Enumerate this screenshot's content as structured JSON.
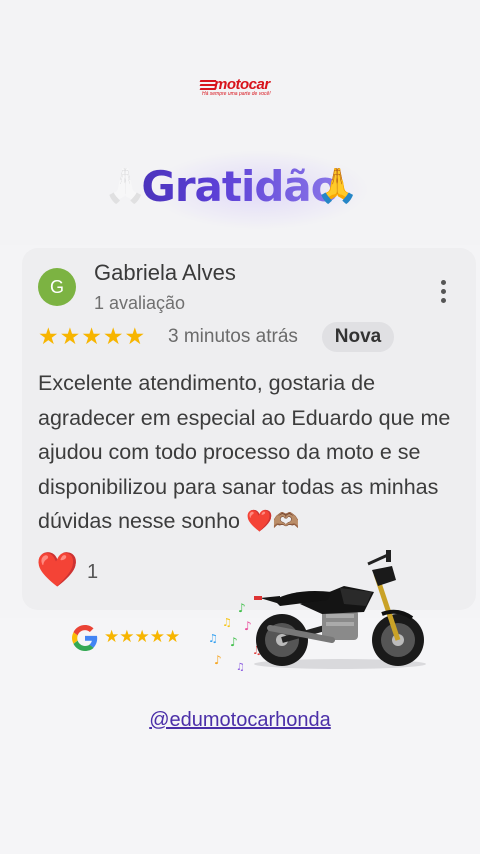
{
  "brand": {
    "name": "motocar",
    "tagline": "Há sempre uma parte de você!"
  },
  "header": {
    "title": "Gratidão",
    "title_emoji": "🙏"
  },
  "review": {
    "avatar_initial": "G",
    "reviewer_name": "Gabriela Alves",
    "review_count": "1 avaliação",
    "rating": 5,
    "stars": [
      "★",
      "★",
      "★",
      "★",
      "★"
    ],
    "time": "3 minutos atrás",
    "badge": "Nova",
    "text": "Excelente atendimento, gostaria de agradecer em especial ao Eduardo que me ajudou com todo processo da moto e se disponibilizou para sanar todas as minhas dúvidas nesse sonho ❤️🫶🏽",
    "reaction_icon": "❤️",
    "reaction_count": "1"
  },
  "google_rating": {
    "stars": [
      "★",
      "★",
      "★",
      "★",
      "★"
    ]
  },
  "footer": {
    "handle": "@edumotocarhonda"
  },
  "colors": {
    "brand_red": "#d8141c",
    "star_gold": "#f7b500",
    "avatar_green": "#7cb342",
    "handle_purple": "#4b2fa8"
  },
  "icons": [
    "kebab-menu-icon",
    "google-g-icon",
    "heart-icon",
    "pray-hands-icon",
    "motorcycle-icon",
    "music-notes-icon"
  ]
}
